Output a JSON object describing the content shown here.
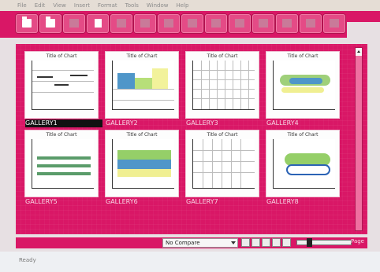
{
  "menu": [
    "File",
    "Edit",
    "View",
    "Insert",
    "Format",
    "Tools",
    "Window",
    "Help"
  ],
  "toolbar": {
    "buttons": [
      "open-folder",
      "open",
      "print",
      "new-doc",
      "copy",
      "cut",
      "paste",
      "undo",
      "redo",
      "zoom",
      "chart",
      "help",
      "options",
      "about"
    ]
  },
  "gallery": {
    "items": [
      {
        "caption": "GALLERY1",
        "title": "Title of Chart",
        "selected": true
      },
      {
        "caption": "GALLERY2",
        "title": "Title of Chart",
        "selected": false
      },
      {
        "caption": "GALLERY3",
        "title": "Title of Chart",
        "selected": false
      },
      {
        "caption": "GALLERY4",
        "title": "Title of Chart",
        "selected": false
      },
      {
        "caption": "GALLERY5",
        "title": "Title of Chart",
        "selected": false
      },
      {
        "caption": "GALLERY6",
        "title": "Title of Chart",
        "selected": false
      },
      {
        "caption": "GALLERY7",
        "title": "Title of Chart",
        "selected": false
      },
      {
        "caption": "GALLERY8",
        "title": "Title of Chart",
        "selected": false
      }
    ]
  },
  "footer": {
    "zoom_value": "No Compare",
    "page_label": "Page"
  },
  "status": {
    "text": "Ready"
  }
}
